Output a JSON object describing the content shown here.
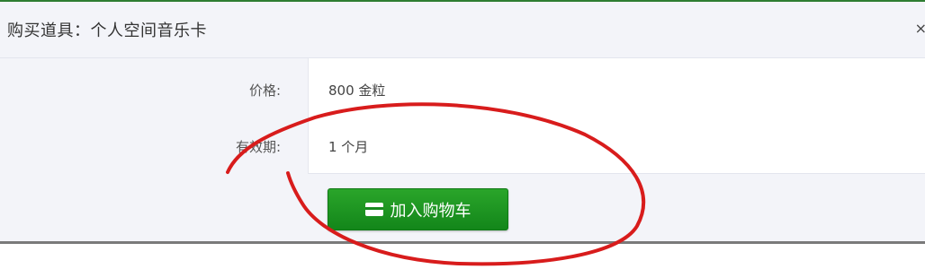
{
  "dialog": {
    "title": "购买道具：个人空间音乐卡",
    "close_symbol": "×"
  },
  "details": {
    "price_label": "价格:",
    "price_value": "800 金粒",
    "validity_label": "有效期:",
    "validity_value": "1 个月"
  },
  "actions": {
    "add_to_cart_label": "加入购物车",
    "add_to_cart_icon": "card-icon"
  },
  "colors": {
    "button_green": "#1a961f",
    "annotation_red": "#d81c1c",
    "header_strip": "#2e7d32"
  }
}
